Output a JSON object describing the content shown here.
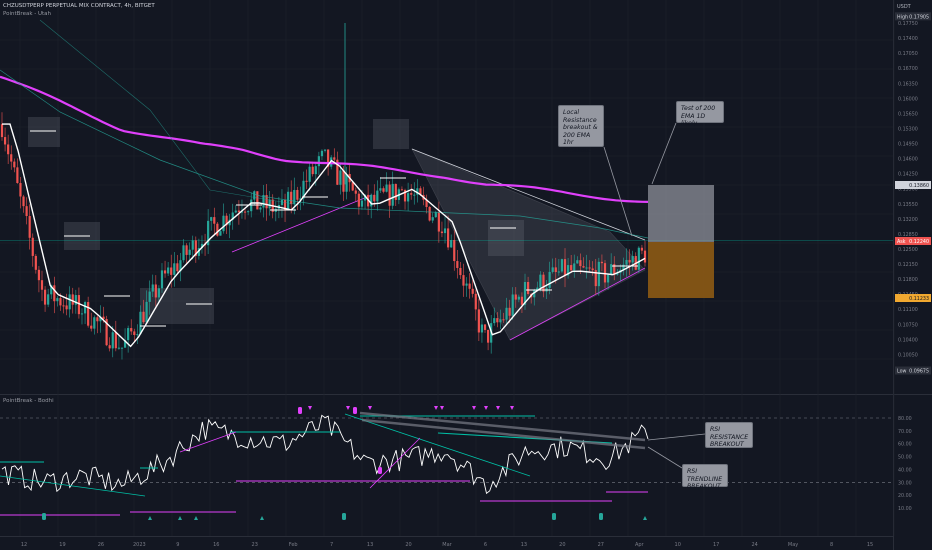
{
  "header": {
    "symbol_line": "CHZUSDTPERP PERPETUAL MIX CONTRACT, 4h, BITGET",
    "indicator_line": "PointBreak - Utah",
    "rsi_title": "PointBreak - Bodhi"
  },
  "price_axis": {
    "currency": "USDT",
    "high_tag": "High",
    "high_value": "0.17905",
    "low_tag": "Low",
    "low_value": "0.09675",
    "ask_tag": "Ask",
    "ask_value": "0.12240",
    "target_value": "0.13860",
    "stop_value": "0.11233"
  },
  "rsi_axis_labels": [
    "80.00",
    "70.00",
    "60.00",
    "50.00",
    "40.00",
    "30.00",
    "20.00",
    "10.00"
  ],
  "time_axis_labels": [
    "12",
    "19",
    "26",
    "2023",
    "9",
    "16",
    "23",
    "Feb",
    "7",
    "13",
    "20",
    "Mar",
    "6",
    "13",
    "20",
    "27",
    "Apr",
    "10",
    "17",
    "24",
    "May",
    "8",
    "15"
  ],
  "notes": {
    "local_resistance": [
      "Local",
      "Resistance",
      "breakout &",
      "200 EMA 1hr",
      "breakout"
    ],
    "test_200": [
      "Test of 200",
      "EMA 1D likely"
    ],
    "rsi_resistance": [
      "RSI",
      "RESISTANCE",
      "BREAKOUT"
    ],
    "rsi_trendline": [
      "RSI TRENDLINE",
      "BREAKOUT"
    ]
  },
  "colors": {
    "background": "#131722",
    "up_candle": "#26a69a",
    "down_candle": "#ef5350",
    "ema_long": "#e040fb",
    "fast_ma": "#ffffff",
    "support_line": "#e040fb",
    "resistance_line": "#00bfa5",
    "target_zone": "#9598a1",
    "stop_zone": "#8d5a14"
  },
  "chart_data": [
    {
      "type": "line",
      "title": "CHZUSDTPERP PERPETUAL MIX CONTRACT, 4h, BITGET",
      "xlabel": "",
      "ylabel": "USDT",
      "ylim": [
        0.0925,
        0.1805
      ],
      "grid": true,
      "x": [
        "Dec 12",
        "Dec 19",
        "Dec 26",
        "Jan 2",
        "Jan 9",
        "Jan 16",
        "Jan 23",
        "Feb 1",
        "Feb 7",
        "Feb 13",
        "Feb 20",
        "Mar 1",
        "Mar 6",
        "Mar 13",
        "Mar 20",
        "Mar 27",
        "Apr 1"
      ],
      "series": [
        {
          "name": "close",
          "values": [
            0.154,
            0.115,
            0.111,
            0.102,
            0.118,
            0.128,
            0.136,
            0.134,
            0.146,
            0.135,
            0.139,
            0.131,
            0.104,
            0.115,
            0.12,
            0.119,
            0.124
          ]
        },
        {
          "name": "ema",
          "values": [
            0.165,
            0.161,
            0.157,
            0.153,
            0.151,
            0.149,
            0.148,
            0.146,
            0.145,
            0.144,
            0.143,
            0.142,
            0.14,
            0.139,
            0.138,
            0.137,
            0.136
          ]
        }
      ],
      "annotations": [
        "Local Resistance breakout & 200 EMA 1hr breakout",
        "Test of 200 EMA 1D likely"
      ],
      "levels": {
        "high": 0.17905,
        "low": 0.09675,
        "ask": 0.1224,
        "target": 0.1386,
        "stop": 0.11233
      }
    },
    {
      "type": "line",
      "title": "PointBreak - Bodhi",
      "ylim": [
        10,
        85
      ],
      "x": [
        "Dec 12",
        "Dec 19",
        "Dec 26",
        "Jan 2",
        "Jan 9",
        "Jan 16",
        "Jan 23",
        "Feb 1",
        "Feb 7",
        "Feb 13",
        "Feb 20",
        "Mar 1",
        "Mar 6",
        "Mar 13",
        "Mar 20",
        "Mar 27",
        "Apr 1"
      ],
      "series": [
        {
          "name": "RSI",
          "values": [
            38,
            30,
            35,
            28,
            45,
            72,
            65,
            60,
            76,
            45,
            48,
            55,
            28,
            55,
            58,
            48,
            70
          ]
        }
      ],
      "levels": [
        70,
        30
      ],
      "annotations": [
        "RSI RESISTANCE BREAKOUT",
        "RSI TRENDLINE BREAKOUT"
      ]
    }
  ]
}
